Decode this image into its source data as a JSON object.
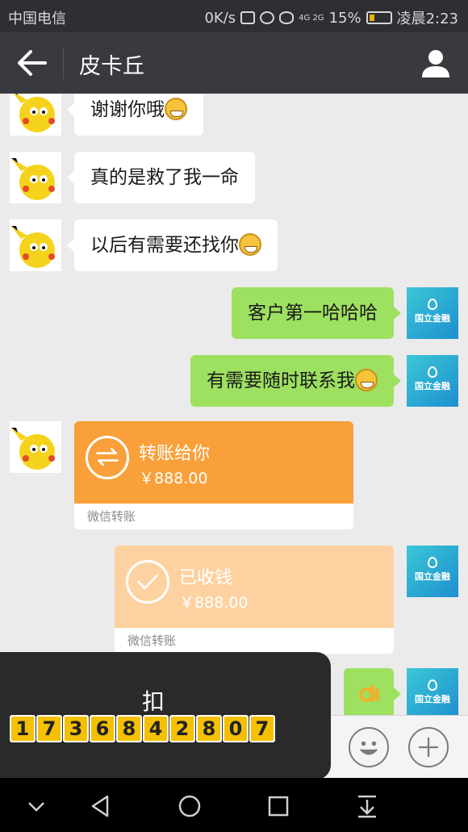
{
  "status_bar": {
    "carrier": "中国电信",
    "speed": "0K/s",
    "network": "4G 2G",
    "battery": "15%",
    "time": "凌晨2:23"
  },
  "header": {
    "title": "皮卡丘"
  },
  "messages": [
    {
      "side": "left",
      "text": "谢谢你哦",
      "emoji": "grin"
    },
    {
      "side": "left",
      "text": "真的是救了我一命"
    },
    {
      "side": "left",
      "text": "以后有需要还找你",
      "emoji": "thinking"
    },
    {
      "side": "right",
      "text": "客户第一哈哈哈"
    },
    {
      "side": "right",
      "text": "有需要随时联系我",
      "emoji": "grin"
    }
  ],
  "transfer_sent": {
    "title": "转账给你",
    "amount": "￥888.00",
    "footer": "微信转账"
  },
  "transfer_received": {
    "title": "已收钱",
    "amount": "￥888.00",
    "footer": "微信转账"
  },
  "bank_logo_text": "国立金融",
  "overlay": {
    "char": "扣",
    "digits": [
      "1",
      "7",
      "3",
      "6",
      "8",
      "4",
      "2",
      "8",
      "0",
      "7"
    ]
  },
  "colors": {
    "header_bg": "#393a3f",
    "bubble_green": "#9ee060",
    "transfer_orange": "#f9a03a",
    "transfer_received": "#fdd2a0"
  }
}
